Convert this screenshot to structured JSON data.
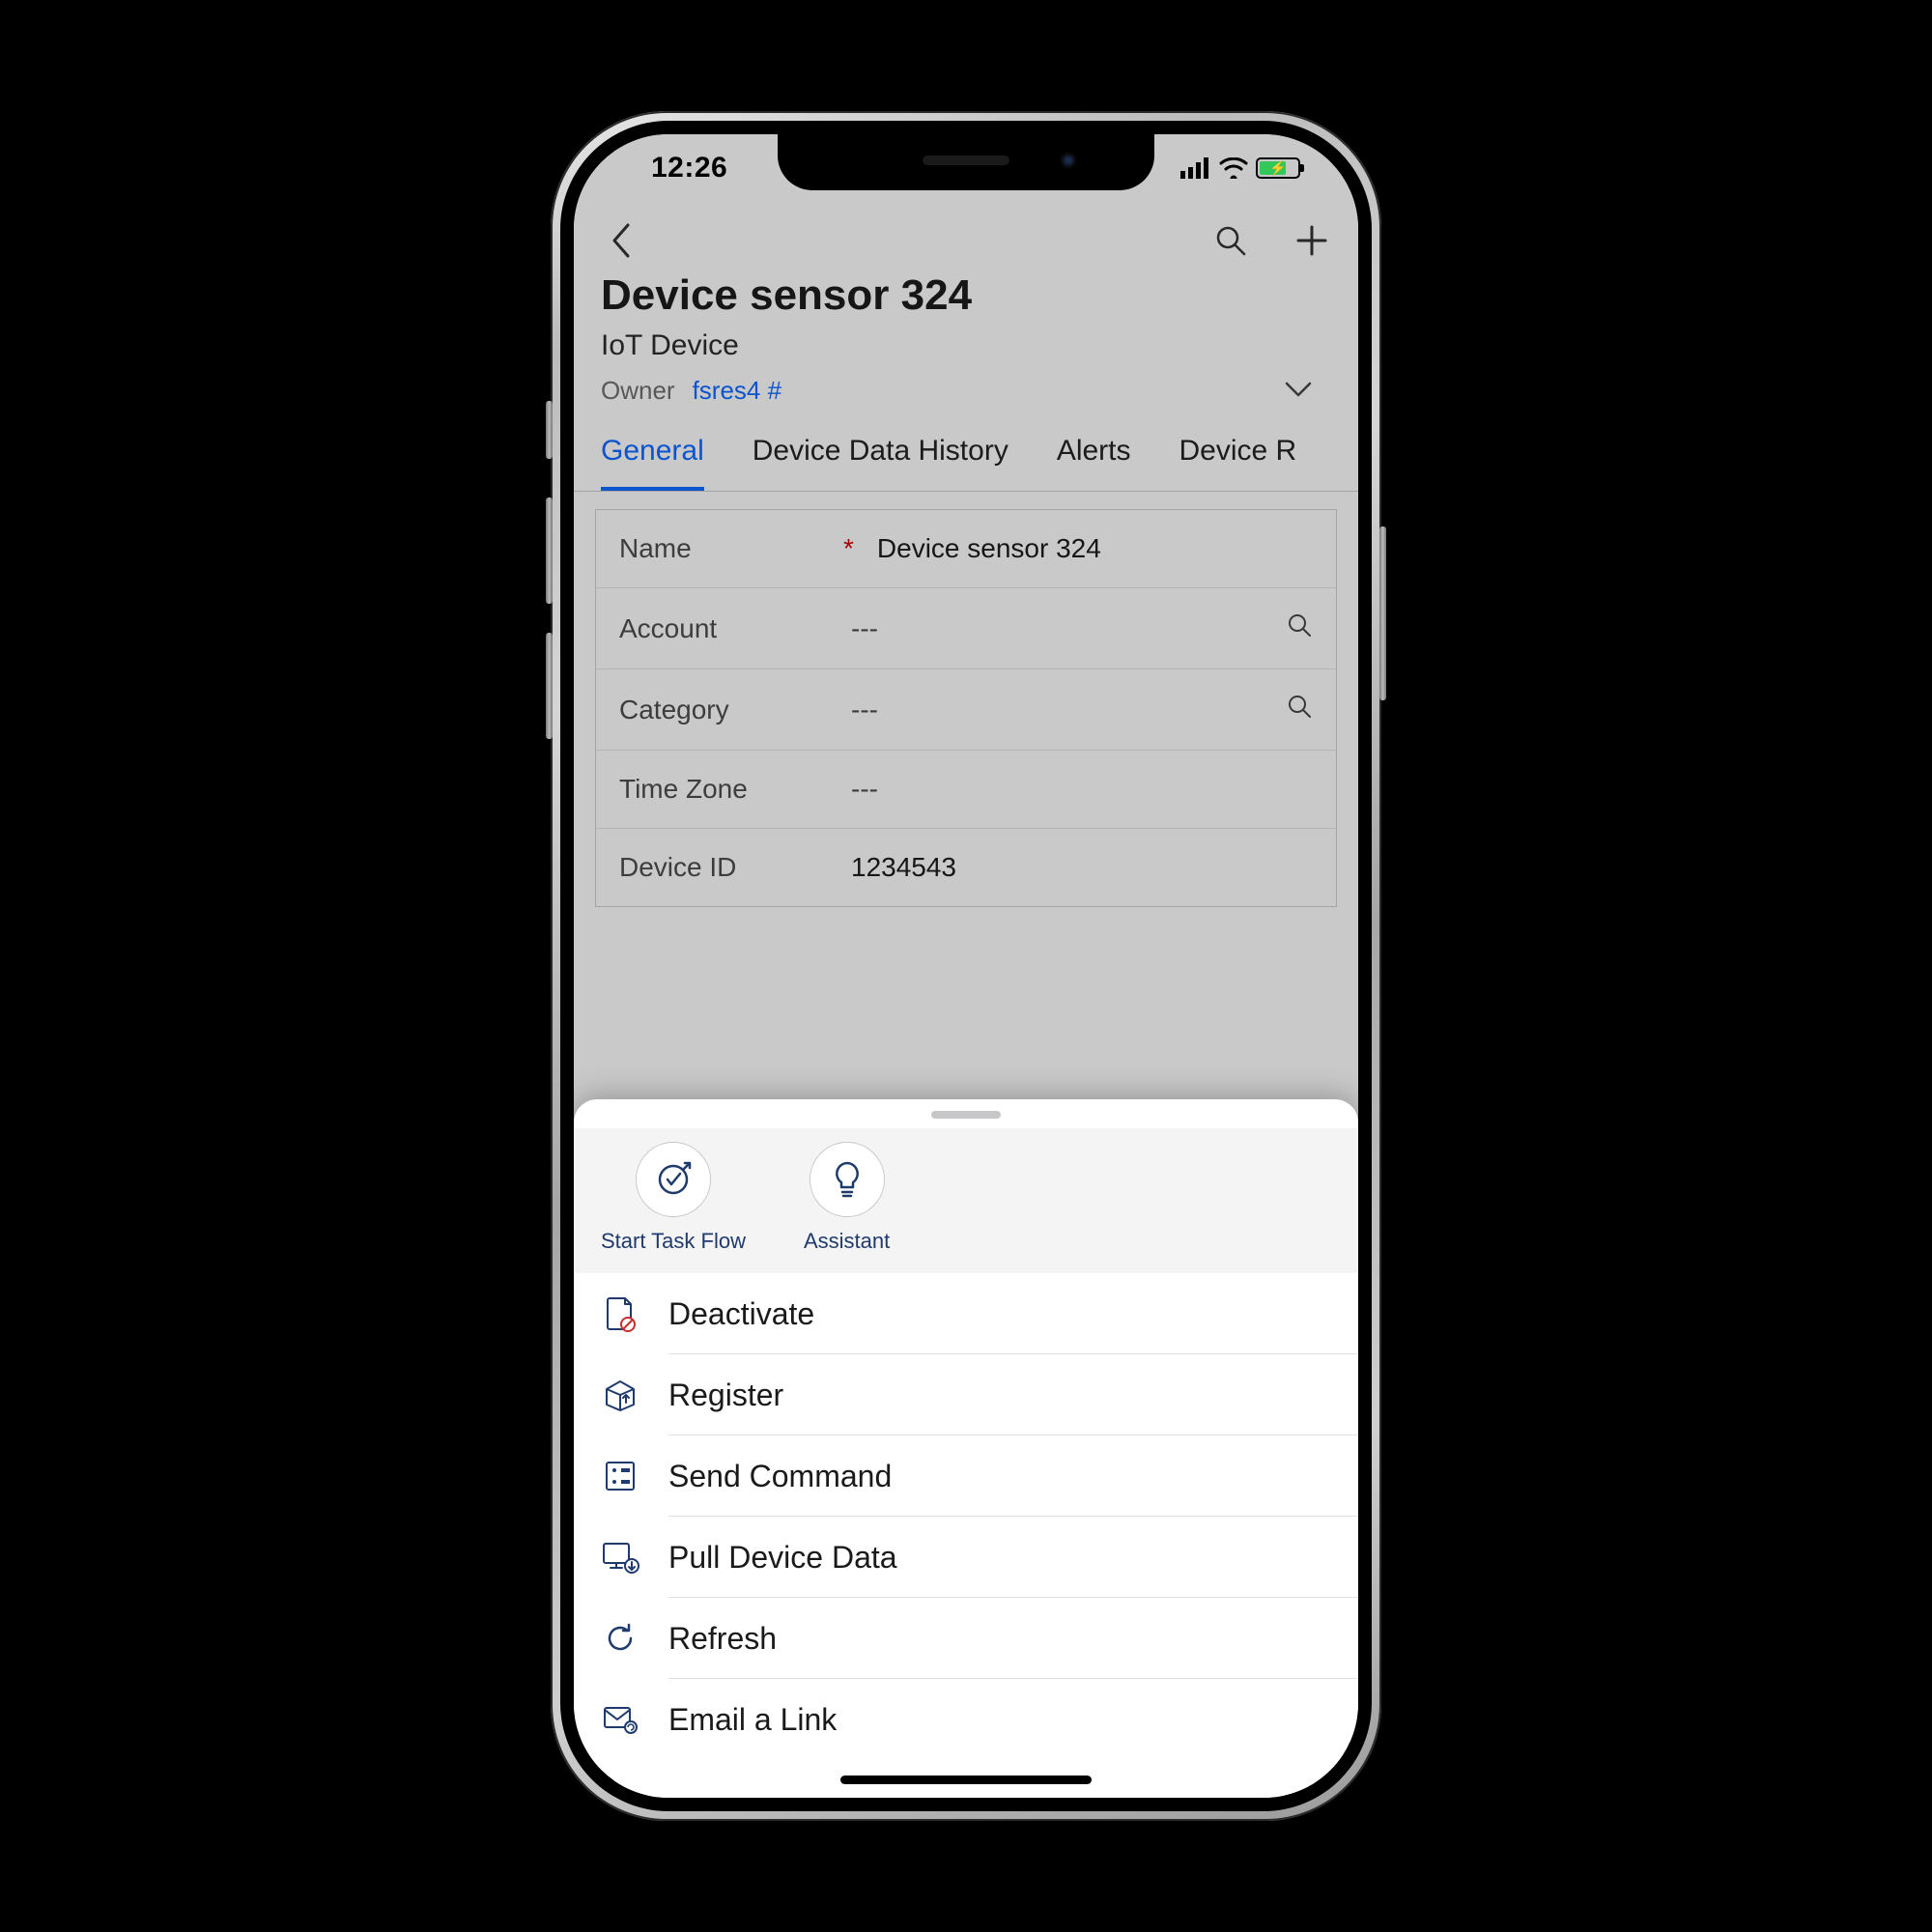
{
  "status": {
    "time": "12:26"
  },
  "header": {
    "title": "Device sensor 324",
    "subtitle": "IoT Device",
    "owner_label": "Owner",
    "owner_value": "fsres4 #"
  },
  "tabs": [
    {
      "label": "General",
      "active": true
    },
    {
      "label": "Device Data History",
      "active": false
    },
    {
      "label": "Alerts",
      "active": false
    },
    {
      "label": "Device R",
      "active": false
    }
  ],
  "fields": {
    "name": {
      "label": "Name",
      "value": "Device sensor 324",
      "required": true
    },
    "account": {
      "label": "Account",
      "value": "---",
      "lookup": true
    },
    "category": {
      "label": "Category",
      "value": "---",
      "lookup": true
    },
    "timezone": {
      "label": "Time Zone",
      "value": "---"
    },
    "device_id": {
      "label": "Device ID",
      "value": "1234543"
    }
  },
  "quick_actions": {
    "task_flow": "Start Task Flow",
    "assistant": "Assistant"
  },
  "menu": {
    "deactivate": "Deactivate",
    "register": "Register",
    "send_command": "Send Command",
    "pull_data": "Pull Device Data",
    "refresh": "Refresh",
    "email_link": "Email a Link"
  }
}
